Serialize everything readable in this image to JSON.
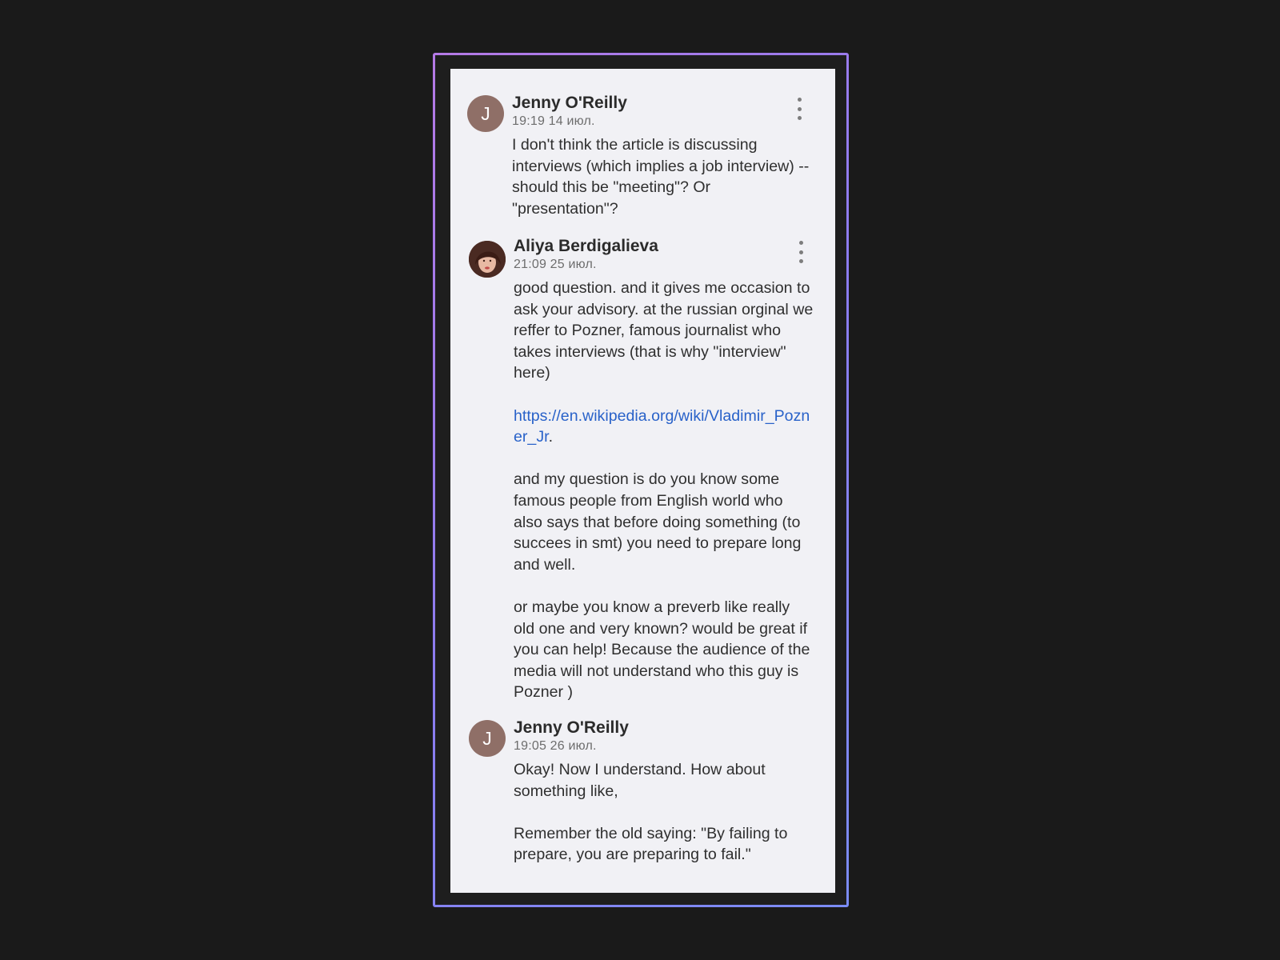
{
  "comments": [
    {
      "author": "Jenny O'Reilly",
      "initial": "J",
      "avatar_color": "#8f6f67",
      "timestamp": "19:19 14 июл.",
      "menu_icon": "more-vert-icon",
      "paragraphs": [
        "I don't think the article is discussing interviews (which implies a job interview) -- should this be \"meeting\"? Or \"presentation\"?"
      ]
    },
    {
      "author": "Aliya Berdigalieva",
      "avatar_kind": "photo",
      "timestamp": "21:09 25 июл.",
      "menu_icon": "more-vert-icon",
      "paragraph_1": "good question. and it gives me occasion to ask your advisory. at the russian orginal we reffer to Pozner, famous journalist who takes interviews (that is why \"interview\" here)",
      "link_url": "https://en.wikipedia.org/wiki/Vladimir_Pozner_Jr",
      "link_suffix": ".",
      "paragraph_3": "and my question is do you know some famous people from English world who also says that before doing something (to succees in smt) you need to prepare long and well.",
      "paragraph_4": "or maybe you know a preverb like really old one and very known? would be great if you can help! Because the audience of the media will not understand who this guy is Pozner )"
    },
    {
      "author": "Jenny O'Reilly",
      "initial": "J",
      "avatar_color": "#8f6f67",
      "timestamp": "19:05 26 июл.",
      "paragraphs": [
        "Okay! Now I understand. How about something like,",
        "Remember the old saying: \"By failing to prepare, you are preparing to fail.\""
      ]
    }
  ],
  "colors": {
    "page_background": "#1a1a1a",
    "panel_background": "#f1f1f5",
    "frame_gradient_start": "#b57ae6",
    "frame_gradient_end": "#7b8cf5",
    "link": "#2962c9"
  }
}
